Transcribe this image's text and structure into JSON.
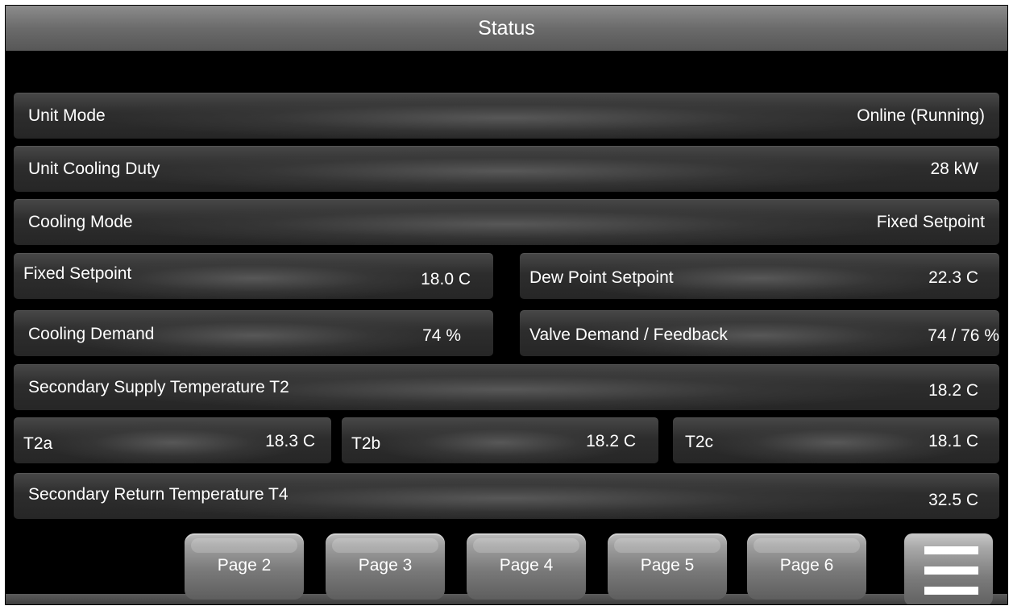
{
  "header": {
    "title": "Status"
  },
  "status": {
    "unit_mode": {
      "label": "Unit Mode",
      "value": "Online (Running)"
    },
    "unit_cooling_duty": {
      "label": "Unit Cooling Duty",
      "value": "28 kW"
    },
    "cooling_mode": {
      "label": "Cooling Mode",
      "value": "Fixed Setpoint"
    },
    "fixed_setpoint": {
      "label": "Fixed Setpoint",
      "value": "18.0 C"
    },
    "dew_point_setpoint": {
      "label": "Dew Point Setpoint",
      "value": "22.3 C"
    },
    "cooling_demand": {
      "label": "Cooling Demand",
      "value": "74 %"
    },
    "valve_demand_feedback": {
      "label": "Valve Demand / Feedback",
      "value": "74 / 76 %"
    },
    "secondary_supply_t2": {
      "label": "Secondary Supply Temperature T2",
      "value": "18.2 C"
    },
    "t2a": {
      "label": "T2a",
      "value": "18.3 C"
    },
    "t2b": {
      "label": "T2b",
      "value": "18.2 C"
    },
    "t2c": {
      "label": "T2c",
      "value": "18.1 C"
    },
    "secondary_return_t4": {
      "label": "Secondary Return Temperature T4",
      "value": "32.5 C"
    }
  },
  "nav": {
    "pages": [
      "Page 2",
      "Page 3",
      "Page 4",
      "Page 5",
      "Page 6"
    ],
    "menu_icon": "hamburger-menu-icon"
  }
}
